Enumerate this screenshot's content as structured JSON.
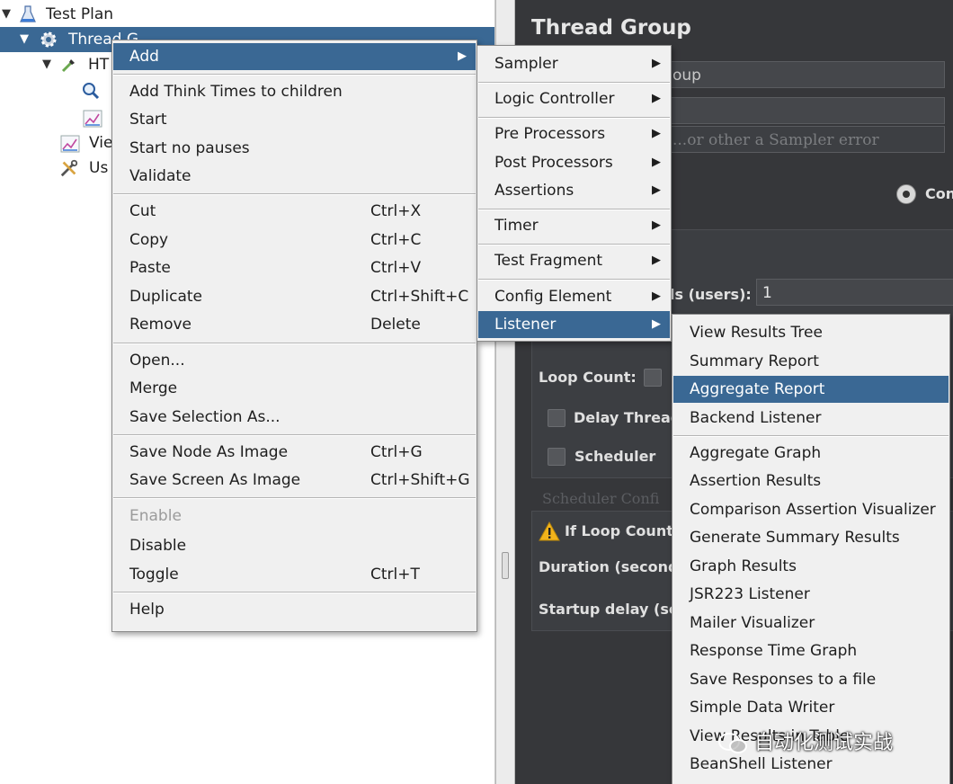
{
  "tree": {
    "items": [
      {
        "label": "Test Plan",
        "icon": "flask-icon"
      },
      {
        "label": "Thread G",
        "icon": "gear-icon"
      },
      {
        "label": "HT",
        "icon": "pipette-icon"
      },
      {
        "label": "",
        "icon": "magnifier-icon"
      },
      {
        "label": "",
        "icon": "graph-icon"
      },
      {
        "label": "Vie",
        "icon": "graph-icon"
      },
      {
        "label": "Us",
        "icon": "tools-icon"
      }
    ]
  },
  "panel": {
    "title": "Thread Group",
    "name_value": "oup",
    "error_text": "...or other a Sampler error",
    "radio_label": "Con",
    "users_label": "ls (users):",
    "users_value": "1",
    "loop_label": "Loop Count:",
    "delay_label": "Delay Thread",
    "scheduler_label": "Scheduler",
    "scheduler_config": "Scheduler Confi",
    "warning_text": "If Loop Count i",
    "duration_label": "Duration (second",
    "startup_label": "Startup delay (sec"
  },
  "context_menu": {
    "items": [
      {
        "label": "Add",
        "submenu": true,
        "highlighted": true
      },
      {
        "label": "Add Think Times to children"
      },
      {
        "label": "Start"
      },
      {
        "label": "Start no pauses"
      },
      {
        "label": "Validate"
      },
      {
        "label": "Cut",
        "shortcut": "Ctrl+X"
      },
      {
        "label": "Copy",
        "shortcut": "Ctrl+C"
      },
      {
        "label": "Paste",
        "shortcut": "Ctrl+V"
      },
      {
        "label": "Duplicate",
        "shortcut": "Ctrl+Shift+C"
      },
      {
        "label": "Remove",
        "shortcut": "Delete"
      },
      {
        "label": "Open..."
      },
      {
        "label": "Merge"
      },
      {
        "label": "Save Selection As..."
      },
      {
        "label": "Save Node As Image",
        "shortcut": "Ctrl+G"
      },
      {
        "label": "Save Screen As Image",
        "shortcut": "Ctrl+Shift+G"
      },
      {
        "label": "Enable",
        "disabled": true
      },
      {
        "label": "Disable"
      },
      {
        "label": "Toggle",
        "shortcut": "Ctrl+T"
      },
      {
        "label": "Help"
      }
    ]
  },
  "add_menu": {
    "items": [
      {
        "label": "Sampler",
        "submenu": true
      },
      {
        "label": "Logic Controller",
        "submenu": true
      },
      {
        "label": "Pre Processors",
        "submenu": true
      },
      {
        "label": "Post Processors",
        "submenu": true
      },
      {
        "label": "Assertions",
        "submenu": true
      },
      {
        "label": "Timer",
        "submenu": true
      },
      {
        "label": "Test Fragment",
        "submenu": true
      },
      {
        "label": "Config Element",
        "submenu": true
      },
      {
        "label": "Listener",
        "submenu": true,
        "highlighted": true
      }
    ]
  },
  "listener_menu": {
    "items": [
      {
        "label": "View Results Tree"
      },
      {
        "label": "Summary Report"
      },
      {
        "label": "Aggregate Report",
        "highlighted": true
      },
      {
        "label": "Backend Listener"
      },
      {
        "label": "Aggregate Graph"
      },
      {
        "label": "Assertion Results"
      },
      {
        "label": "Comparison Assertion Visualizer"
      },
      {
        "label": "Generate Summary Results"
      },
      {
        "label": "Graph Results"
      },
      {
        "label": "JSR223 Listener"
      },
      {
        "label": "Mailer Visualizer"
      },
      {
        "label": "Response Time Graph"
      },
      {
        "label": "Save Responses to a file"
      },
      {
        "label": "Simple Data Writer"
      },
      {
        "label": "View Results in Table"
      },
      {
        "label": "BeanShell Listener"
      }
    ]
  },
  "watermark": "自动化测试实战",
  "colors": {
    "highlight": "#3a6894",
    "menu_bg": "#f0f0f0",
    "panel_bg": "#36373a"
  }
}
